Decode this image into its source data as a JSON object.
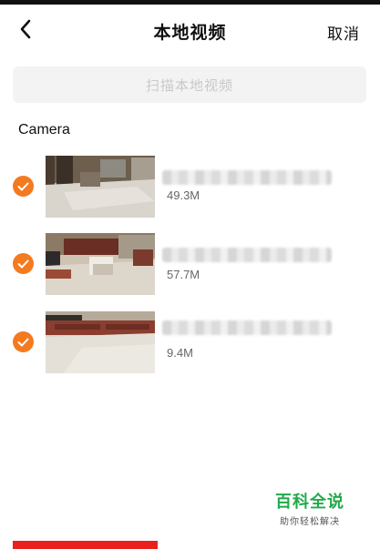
{
  "header": {
    "title": "本地视频",
    "cancel_label": "取消",
    "back_icon": "chevron-left-icon"
  },
  "scan_button": {
    "label": "扫描本地视频"
  },
  "section": {
    "title": "Camera"
  },
  "videos": [
    {
      "size": "49.3M",
      "selected": true,
      "thumbnail": "room-floor-tiles"
    },
    {
      "size": "57.7M",
      "selected": true,
      "thumbnail": "room-bags-tv-stand"
    },
    {
      "size": "9.4M",
      "selected": true,
      "thumbnail": "tv-stand-floor"
    }
  ],
  "watermark": {
    "main": "百科全说",
    "sub": "助你轻松解决"
  },
  "colors": {
    "accent": "#f47a20",
    "watermark": "#22a94a",
    "bottom_bar": "#e8201e"
  }
}
